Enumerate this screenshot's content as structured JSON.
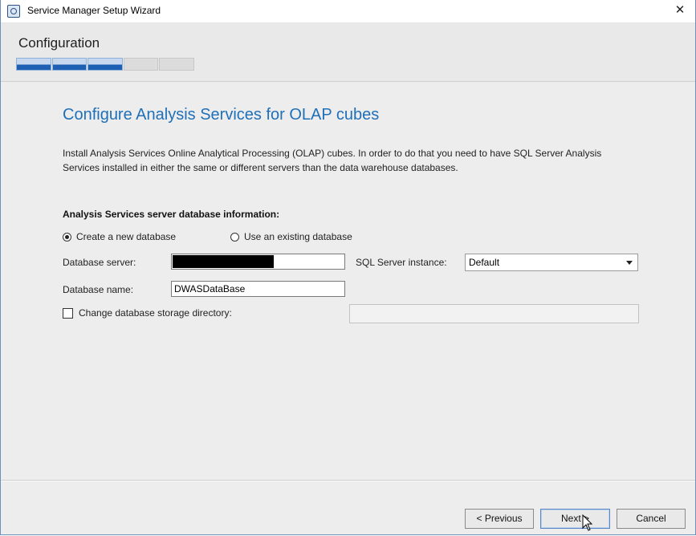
{
  "window": {
    "title": "Service Manager Setup Wizard",
    "close_glyph": "✕",
    "app_icon": "setup-wizard-icon"
  },
  "header": {
    "title": "Configuration",
    "progress": {
      "total_steps": 5,
      "completed_steps": 3
    }
  },
  "page": {
    "heading": "Configure Analysis Services for OLAP cubes",
    "description": "Install Analysis Services Online Analytical Processing (OLAP) cubes. In order to do that you need to have SQL Server Analysis Services installed in either the same or different servers than the data warehouse databases.",
    "section_label": "Analysis Services server database information:",
    "options": {
      "create_new": {
        "label": "Create a new database",
        "selected": true
      },
      "use_existing": {
        "label": "Use an existing database",
        "selected": false
      }
    },
    "database_server": {
      "label": "Database server:",
      "value": "",
      "redacted": true
    },
    "sql_instance": {
      "label": "SQL Server instance:",
      "selected": "Default"
    },
    "database_name": {
      "label": "Database name:",
      "value": "DWASDataBase"
    },
    "storage_directory": {
      "label": "Change database storage directory:",
      "checked": false,
      "value": ""
    }
  },
  "footer": {
    "previous_label": "< Previous",
    "next_label": "Next >",
    "cancel_label": "Cancel"
  },
  "colors": {
    "heading": "#1f70b8",
    "progress_done": "#1c5fb3",
    "progress_pending": "#dcdcdc"
  }
}
